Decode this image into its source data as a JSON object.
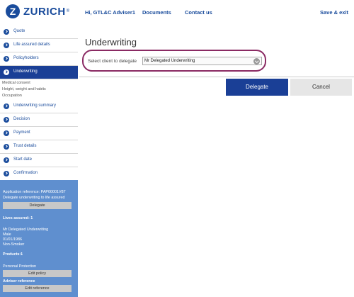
{
  "header": {
    "brand": "ZURICH",
    "brand_mark": "®",
    "greeting": "Hi, GTL&C Adviser1",
    "documents": "Documents",
    "contact": "Contact us",
    "save_exit": "Save & exit"
  },
  "sidebar": {
    "items": [
      {
        "label": "Quote"
      },
      {
        "label": "Life assured details"
      },
      {
        "label": "Policyholders"
      },
      {
        "label": "Underwriting"
      },
      {
        "label": "Underwriting summary"
      },
      {
        "label": "Decision"
      },
      {
        "label": "Payment"
      },
      {
        "label": "Trust details"
      },
      {
        "label": "Start date"
      },
      {
        "label": "Confirmation"
      }
    ],
    "sub_items": [
      "Medical consent",
      "Height, weight and habits",
      "Occupation"
    ]
  },
  "panel": {
    "app_ref": "Application reference: PAP00001V87",
    "delegate_note": "Delegate underwriting to life assured",
    "delegate_btn": "Delegate",
    "lives_assured": "Lives assured: 1",
    "person_name": "Mr Delegated Underwriting",
    "person_gender": "Male",
    "person_dob": "01/01/1986",
    "person_smoker": "Non-Smoker",
    "products": "Products:1",
    "product_name": "Personal Protection",
    "edit_policy": "Edit policy",
    "adviser_ref": "Adviser reference",
    "edit_reference": "Edit reference"
  },
  "main": {
    "title": "Underwriting",
    "select_label": "Select client to delegate",
    "select_value": "Mr Delegated Underwriting",
    "delegate_btn": "Delegate",
    "cancel_btn": "Cancel"
  },
  "colors": {
    "brand_blue": "#1a4c9c",
    "active_blue": "#1a3f96",
    "panel_blue": "#5f8fcf",
    "highlight": "#8a2a63"
  }
}
